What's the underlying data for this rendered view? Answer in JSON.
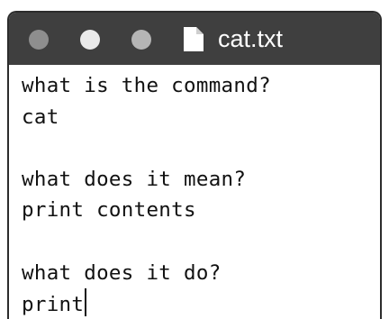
{
  "window": {
    "title": "cat.txt",
    "title_icon": "document-icon",
    "traffic_lights": [
      "close",
      "minimize",
      "zoom"
    ]
  },
  "editor": {
    "lines": [
      "what is the command?",
      "cat",
      "",
      "what does it mean?",
      "print contents",
      "",
      "what does it do?",
      "print"
    ],
    "caret_after_line": 7
  },
  "colors": {
    "titlebar": "#3f3f3f",
    "title_text": "#ffffff",
    "close_light": "#8e8e8e",
    "minimize_light": "#e9e9e9",
    "zoom_light": "#b5b5b5",
    "editor_background": "#ffffff",
    "editor_text": "#111111"
  }
}
